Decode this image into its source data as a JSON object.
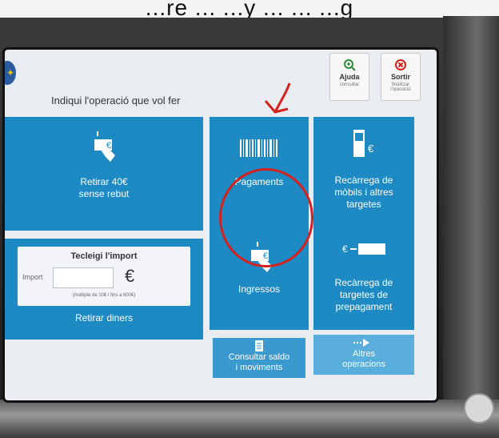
{
  "top_text": "...re ... ...y ... ... ...g",
  "screen": {
    "instruction": "Indiqui l'operació que vol fer",
    "help": {
      "label": "Ajuda",
      "sub": "consultar"
    },
    "exit": {
      "label": "Sortir",
      "sub": "finalitzar l'operació"
    }
  },
  "tiles": {
    "withdraw": "Retirar 40€\nsense rebut",
    "payments": "Pagaments",
    "recharge_mobile": "Recàrrega de\nmòbils i altres\ntargetes",
    "amount": {
      "title": "Tecleigi l'import",
      "field_label": "Import",
      "currency": "€",
      "hint": "(múltiple de 10€ i fins a 600€)",
      "action": "Retirar diners"
    },
    "deposits": "Ingressos",
    "recharge_prepaid": "Recàrrega de\ntargetes de\nprepagament",
    "balance": "Consultar saldo\ni moviments",
    "other": "Altres\noperacions"
  },
  "annotation": {
    "arrow": "↓"
  },
  "colors": {
    "tile": "#1d8ac4",
    "annotation": "#d6201c",
    "screen_bg": "#e9edf2"
  },
  "icons": [
    "search-icon",
    "close-icon",
    "card-money-icon",
    "barcode-icon",
    "mobile-phone-icon",
    "card-icon",
    "document-icon",
    "arrow-right-icon"
  ]
}
